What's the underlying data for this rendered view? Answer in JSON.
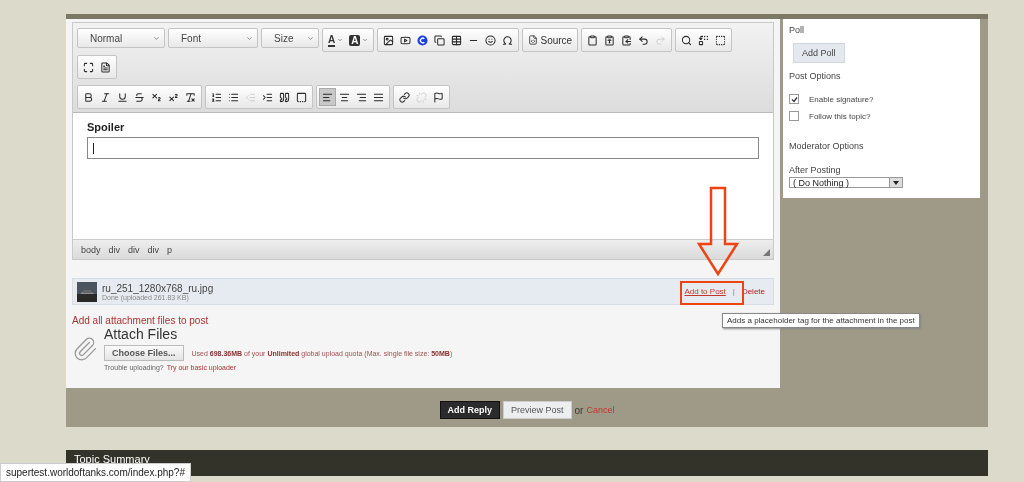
{
  "editor": {
    "combos": [
      "Normal",
      "Font",
      "Size"
    ],
    "color_buttons": [
      "A",
      "A"
    ],
    "source_button": "Source",
    "history_buttons": [
      {
        "disabled": false
      },
      {
        "disabled": true
      }
    ],
    "indent_buttons": [
      {
        "disabled": true
      },
      {
        "disabled": false
      }
    ],
    "align_buttons": [
      {
        "selected": true
      },
      {
        "selected": false
      },
      {
        "selected": false
      },
      {
        "selected": false
      }
    ],
    "link_buttons": [
      {
        "disabled": false
      },
      {
        "disabled": true
      }
    ],
    "content_heading": "Spoiler",
    "elements_path": [
      "body",
      "div",
      "div",
      "div",
      "p"
    ]
  },
  "attachment": {
    "filename": "ru_251_1280x768_ru.jpg",
    "status": "Done (uploaded 261.83 KB)",
    "add_to_post": "Add to Post",
    "separator": "|",
    "delete": "Delete"
  },
  "add_all": "Add all attachment files to post",
  "attach": {
    "title": "Attach Files",
    "button": "Choose Files...",
    "quota": "Used **698.36MB** of your **Unlimited** global upload quota (Max. single file size: **50MB**)",
    "help": "Trouble uploading?",
    "help_link": "Try our basic uploader"
  },
  "tooltip": "Adds a placeholder tag for the attachment in the post",
  "sidebar": {
    "poll_title": "Poll",
    "poll_button": "Add Poll",
    "options_title": "Post Options",
    "options": [
      {
        "label": "Enable signature?",
        "checked": true
      },
      {
        "label": "Follow this topic?",
        "checked": false
      }
    ],
    "moderator_title": "Moderator Options",
    "after_label": "After Posting",
    "after_value": "( Do Nothing )"
  },
  "actions": {
    "submit": "Add Reply",
    "preview": "Preview Post",
    "or": "or",
    "cancel": "Cancel"
  },
  "summary_title": "Topic Summary",
  "status_url": "supertest.worldoftanks.com/index.php?#"
}
